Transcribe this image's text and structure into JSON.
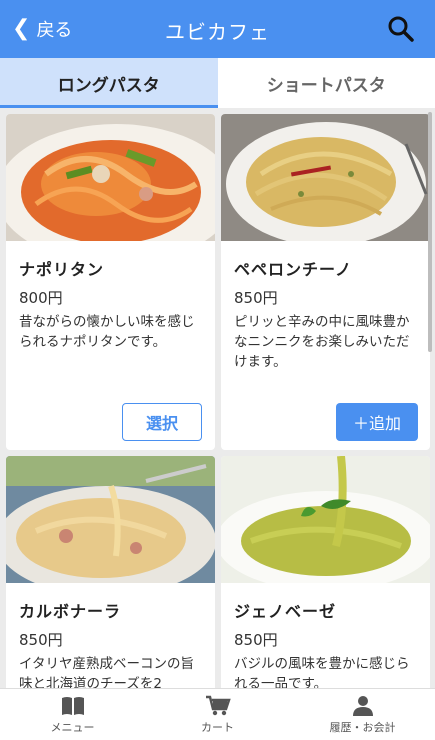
{
  "header": {
    "back_label": "戻る",
    "title": "ユビカフェ"
  },
  "tabs": [
    {
      "label": "ロングパスタ",
      "active": true
    },
    {
      "label": "ショートパスタ",
      "active": false
    }
  ],
  "products": [
    {
      "name": "ナポリタン",
      "price": "800円",
      "description": "昔ながらの懐かしい味を感じられるナポリタンです。",
      "button": "選択"
    },
    {
      "name": "ペペロンチーノ",
      "price": "850円",
      "description": "ピリッと辛みの中に風味豊かなニンニクをお楽しみいただけます。",
      "button": "＋追加"
    },
    {
      "name": "カルボナーラ",
      "price": "850円",
      "description": "イタリヤ産熟成ベーコンの旨味と北海道のチーズを2"
    },
    {
      "name": "ジェノベーゼ",
      "price": "850円",
      "description": "バジルの風味を豊かに感じられる一品です。"
    }
  ],
  "nav": [
    {
      "label": "メニュー",
      "icon": "book-icon"
    },
    {
      "label": "カート",
      "icon": "cart-icon"
    },
    {
      "label": "履歴・お会計",
      "icon": "person-icon"
    }
  ],
  "colors": {
    "accent": "#4a90f0",
    "active_tab_bg": "#cfe1fb",
    "background": "#ebebeb"
  }
}
